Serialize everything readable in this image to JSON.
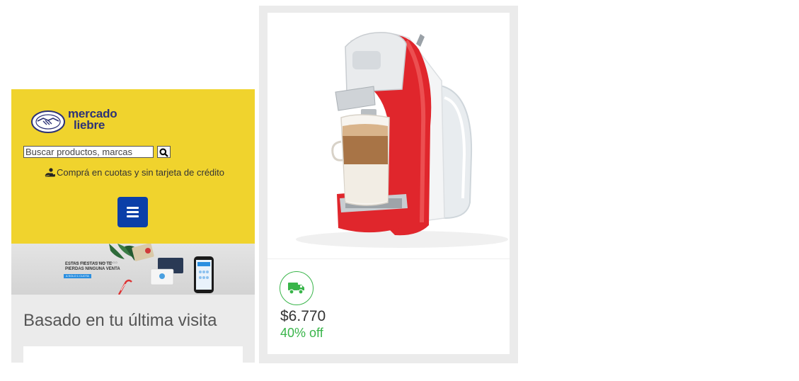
{
  "header": {
    "logo": {
      "line1": "mercado",
      "line2": "liebre"
    },
    "search": {
      "placeholder": "Buscar productos, marcas",
      "value": ""
    },
    "promo_text": "Comprá en cuotas y sin tarjeta de crédito",
    "menu_icon": "hamburger-menu-icon"
  },
  "banner": {
    "small_text": "PAGÁ CON TU MERCADO PAGO",
    "title_line1": "ESTAS FIESTAS NO TE",
    "title_line2": "PIERDAS NINGUNA VENTA",
    "tag_text": "A SOLO 1 CUOTA"
  },
  "section": {
    "title": "Basado en tu última visita"
  },
  "product": {
    "image_alt": "coffee-machine",
    "shipping_icon": "truck-icon",
    "price": "$6.770",
    "discount": "40% off"
  },
  "colors": {
    "header_yellow": "#f0d32d",
    "menu_blue": "#0b3fa8",
    "logo_navy": "#2d3277",
    "discount_green": "#39b54a",
    "machine_red": "#e0262c"
  }
}
